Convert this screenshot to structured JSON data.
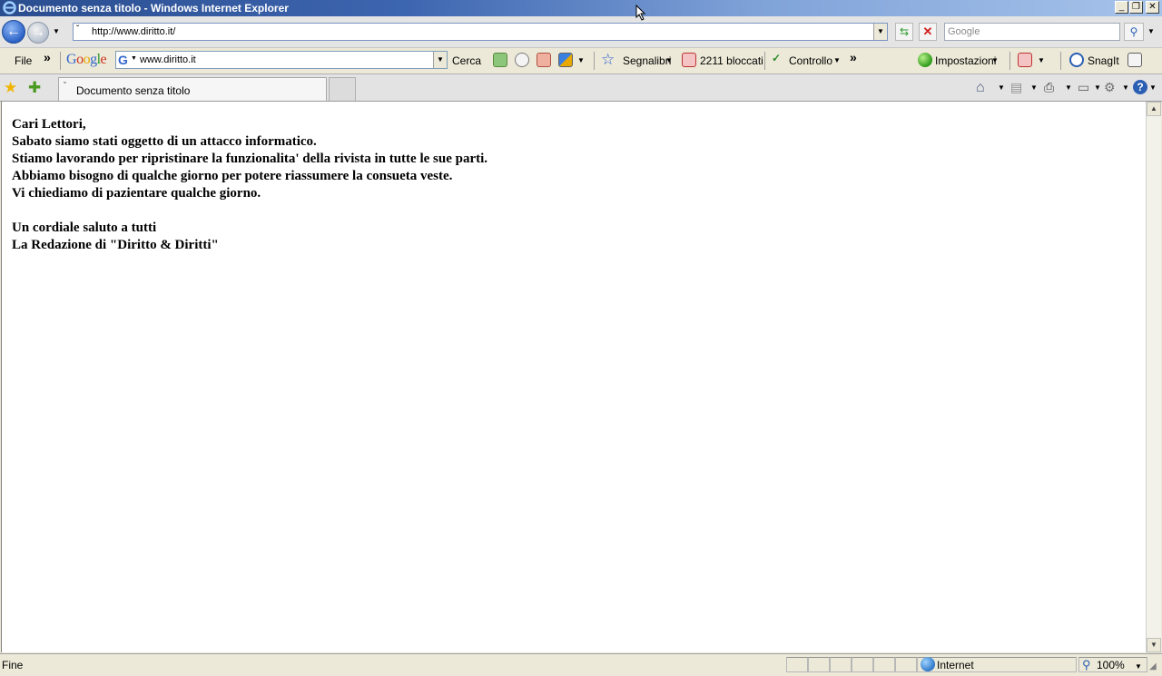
{
  "window": {
    "title": "Documento senza titolo - Windows Internet Explorer"
  },
  "navigation": {
    "address": "http://www.diritto.it/",
    "search_placeholder": "Google"
  },
  "toolbar": {
    "file_menu": "File",
    "overflow_glyph": "»",
    "google_logo": "Google",
    "google_search_value": "www.diritto.it",
    "cerca_label": "Cerca",
    "segnalibri_label": "Segnalibri",
    "bloccati_label": "2211 bloccati",
    "controllo_label": "Controllo",
    "overflow_glyph_2": "»",
    "impostazioni_label": "Impostazioni",
    "snagit_label": "SnagIt"
  },
  "tabs": [
    {
      "label": "Documento senza titolo",
      "active": true
    }
  ],
  "content": {
    "lines": [
      "Cari Lettori,",
      "Sabato siamo stati oggetto di un attacco informatico.",
      "Stiamo lavorando per ripristinare la funzionalita' della rivista in tutte le sue parti.",
      "Abbiamo bisogno di qualche giorno per potere riassumere la consueta veste.",
      "Vi chiediamo di pazientare qualche giorno.",
      "",
      "Un cordiale saluto a tutti",
      "La Redazione di \"Diritto & Diritti\""
    ]
  },
  "statusbar": {
    "status": "Fine",
    "zone": "Internet",
    "zoom": "100%"
  },
  "colors": {
    "titlebar_start": "#2a4d8f",
    "titlebar_end": "#a6c3ea",
    "chrome_bg": "#ece9d8",
    "content_bg": "#ffffff"
  }
}
